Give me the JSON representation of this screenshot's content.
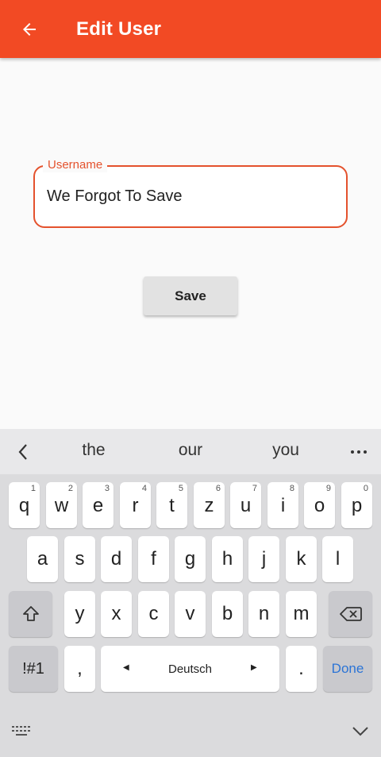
{
  "appbar": {
    "title": "Edit User",
    "color": "#f24a24"
  },
  "form": {
    "username_label": "Username",
    "username_value": "We Forgot To Save",
    "save_label": "Save"
  },
  "keyboard": {
    "suggestions": [
      "the",
      "our",
      "you"
    ],
    "row1": [
      {
        "key": "q",
        "num": "1"
      },
      {
        "key": "w",
        "num": "2"
      },
      {
        "key": "e",
        "num": "3"
      },
      {
        "key": "r",
        "num": "4"
      },
      {
        "key": "t",
        "num": "5"
      },
      {
        "key": "z",
        "num": "6"
      },
      {
        "key": "u",
        "num": "7"
      },
      {
        "key": "i",
        "num": "8"
      },
      {
        "key": "o",
        "num": "9"
      },
      {
        "key": "p",
        "num": "0"
      }
    ],
    "row2": [
      "a",
      "s",
      "d",
      "f",
      "g",
      "h",
      "j",
      "k",
      "l"
    ],
    "row3": [
      "y",
      "x",
      "c",
      "v",
      "b",
      "n",
      "m"
    ],
    "symbols_label": "!#1",
    "comma_label": ",",
    "space_label": "Deutsch",
    "period_label": ".",
    "done_label": "Done",
    "done_color": "#2b74d6"
  }
}
